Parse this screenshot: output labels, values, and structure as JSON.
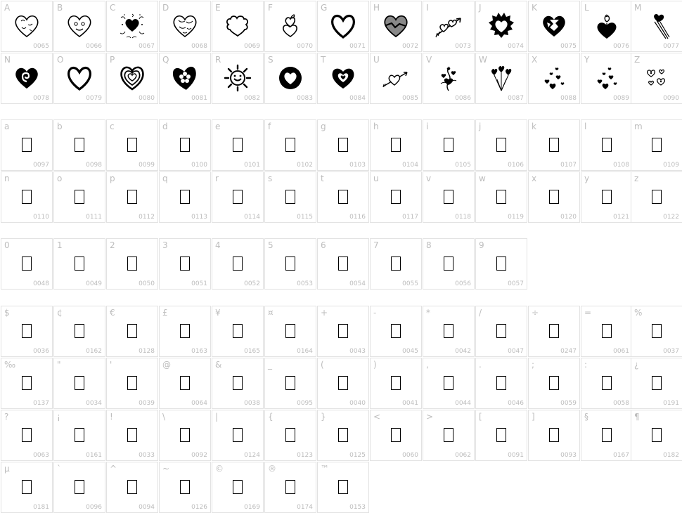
{
  "sections": [
    {
      "name": "uppercase",
      "cells": [
        {
          "label": "A",
          "code": "0065",
          "icon": "heart-doodle-icon"
        },
        {
          "label": "B",
          "code": "0066",
          "icon": "heart-face-icon"
        },
        {
          "label": "C",
          "code": "0067",
          "icon": "heart-swirls-icon"
        },
        {
          "label": "D",
          "code": "0068",
          "icon": "heart-patterned-icon"
        },
        {
          "label": "E",
          "code": "0069",
          "icon": "heart-scalloped-icon"
        },
        {
          "label": "F",
          "code": "0070",
          "icon": "heart-stacked-icon"
        },
        {
          "label": "G",
          "code": "0071",
          "icon": "heart-outline-icon"
        },
        {
          "label": "H",
          "code": "0072",
          "icon": "heart-broken-icon"
        },
        {
          "label": "I",
          "code": "0073",
          "icon": "heart-arrow-icon"
        },
        {
          "label": "J",
          "code": "0074",
          "icon": "heart-spiky-icon"
        },
        {
          "label": "K",
          "code": "0075",
          "icon": "heart-cracked-icon"
        },
        {
          "label": "L",
          "code": "0076",
          "icon": "heart-flame-icon"
        },
        {
          "label": "M",
          "code": "0077",
          "icon": "heart-comet-icon"
        },
        {
          "label": "N",
          "code": "0078",
          "icon": "heart-spiral-icon"
        },
        {
          "label": "O",
          "code": "0079",
          "icon": "heart-outline-icon"
        },
        {
          "label": "P",
          "code": "0080",
          "icon": "heart-scribble-icon"
        },
        {
          "label": "Q",
          "code": "0081",
          "icon": "heart-flower-icon"
        },
        {
          "label": "R",
          "code": "0082",
          "icon": "heart-sun-icon"
        },
        {
          "label": "S",
          "code": "0083",
          "icon": "heart-circle-icon"
        },
        {
          "label": "T",
          "code": "0084",
          "icon": "heart-nested-icon"
        },
        {
          "label": "U",
          "code": "0085",
          "icon": "heart-arrow-small-icon"
        },
        {
          "label": "V",
          "code": "0086",
          "icon": "heart-vine-icon"
        },
        {
          "label": "W",
          "code": "0087",
          "icon": "heart-balloons-icon"
        },
        {
          "label": "X",
          "code": "0088",
          "icon": "heart-scatter-icon"
        },
        {
          "label": "Y",
          "code": "0089",
          "icon": "heart-scatter-icon"
        },
        {
          "label": "Z",
          "code": "0090",
          "icon": "heart-trio-icon"
        }
      ]
    },
    {
      "name": "lowercase",
      "cells": [
        {
          "label": "a",
          "code": "0097"
        },
        {
          "label": "b",
          "code": "0098"
        },
        {
          "label": "c",
          "code": "0099"
        },
        {
          "label": "d",
          "code": "0100"
        },
        {
          "label": "e",
          "code": "0101"
        },
        {
          "label": "f",
          "code": "0102"
        },
        {
          "label": "g",
          "code": "0103"
        },
        {
          "label": "h",
          "code": "0104"
        },
        {
          "label": "i",
          "code": "0105"
        },
        {
          "label": "j",
          "code": "0106"
        },
        {
          "label": "k",
          "code": "0107"
        },
        {
          "label": "l",
          "code": "0108"
        },
        {
          "label": "m",
          "code": "0109"
        },
        {
          "label": "n",
          "code": "0110"
        },
        {
          "label": "o",
          "code": "0111"
        },
        {
          "label": "p",
          "code": "0112"
        },
        {
          "label": "q",
          "code": "0113"
        },
        {
          "label": "r",
          "code": "0114"
        },
        {
          "label": "s",
          "code": "0115"
        },
        {
          "label": "t",
          "code": "0116"
        },
        {
          "label": "u",
          "code": "0117"
        },
        {
          "label": "v",
          "code": "0118"
        },
        {
          "label": "w",
          "code": "0119"
        },
        {
          "label": "x",
          "code": "0120"
        },
        {
          "label": "y",
          "code": "0121"
        },
        {
          "label": "z",
          "code": "0122"
        }
      ]
    },
    {
      "name": "digits",
      "cells": [
        {
          "label": "0",
          "code": "0048"
        },
        {
          "label": "1",
          "code": "0049"
        },
        {
          "label": "2",
          "code": "0050"
        },
        {
          "label": "3",
          "code": "0051"
        },
        {
          "label": "4",
          "code": "0052"
        },
        {
          "label": "5",
          "code": "0053"
        },
        {
          "label": "6",
          "code": "0054"
        },
        {
          "label": "7",
          "code": "0055"
        },
        {
          "label": "8",
          "code": "0056"
        },
        {
          "label": "9",
          "code": "0057"
        }
      ]
    },
    {
      "name": "symbols",
      "cells": [
        {
          "label": "$",
          "code": "0036"
        },
        {
          "label": "¢",
          "code": "0162"
        },
        {
          "label": "€",
          "code": "0128"
        },
        {
          "label": "£",
          "code": "0163"
        },
        {
          "label": "¥",
          "code": "0165"
        },
        {
          "label": "¤",
          "code": "0164"
        },
        {
          "label": "+",
          "code": "0043"
        },
        {
          "label": "-",
          "code": "0045"
        },
        {
          "label": "*",
          "code": "0042"
        },
        {
          "label": "/",
          "code": "0047"
        },
        {
          "label": "÷",
          "code": "0247"
        },
        {
          "label": "=",
          "code": "0061"
        },
        {
          "label": "%",
          "code": "0037"
        },
        {
          "label": "‰",
          "code": "0137"
        },
        {
          "label": "\"",
          "code": "0034"
        },
        {
          "label": "'",
          "code": "0039"
        },
        {
          "label": "@",
          "code": "0064"
        },
        {
          "label": "&",
          "code": "0038"
        },
        {
          "label": "_",
          "code": "0095"
        },
        {
          "label": "(",
          "code": "0040"
        },
        {
          "label": ")",
          "code": "0041"
        },
        {
          "label": ",",
          "code": "0044"
        },
        {
          "label": ".",
          "code": "0046"
        },
        {
          "label": ";",
          "code": "0059"
        },
        {
          "label": ":",
          "code": "0058"
        },
        {
          "label": "¿",
          "code": "0191"
        },
        {
          "label": "?",
          "code": "0063"
        },
        {
          "label": "¡",
          "code": "0161"
        },
        {
          "label": "!",
          "code": "0033"
        },
        {
          "label": "\\",
          "code": "0092"
        },
        {
          "label": "|",
          "code": "0124"
        },
        {
          "label": "{",
          "code": "0123"
        },
        {
          "label": "}",
          "code": "0125"
        },
        {
          "label": "<",
          "code": "0060"
        },
        {
          "label": ">",
          "code": "0062"
        },
        {
          "label": "[",
          "code": "0091"
        },
        {
          "label": "]",
          "code": "0093"
        },
        {
          "label": "§",
          "code": "0167"
        },
        {
          "label": "¶",
          "code": "0182"
        },
        {
          "label": "µ",
          "code": "0181"
        },
        {
          "label": "`",
          "code": "0096"
        },
        {
          "label": "^",
          "code": "0094"
        },
        {
          "label": "~",
          "code": "0126"
        },
        {
          "label": "©",
          "code": "0169"
        },
        {
          "label": "®",
          "code": "0174"
        },
        {
          "label": "™",
          "code": "0153"
        }
      ]
    }
  ]
}
